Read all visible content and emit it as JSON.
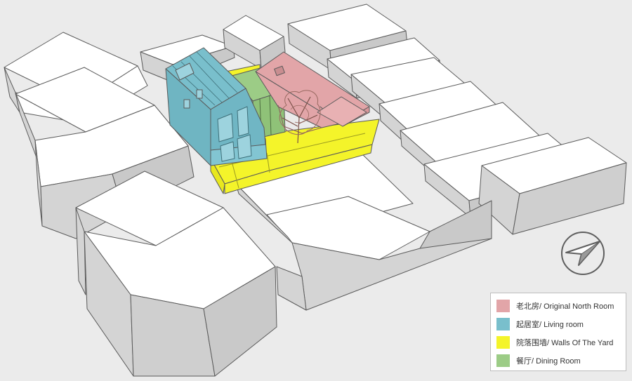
{
  "legend": {
    "items": [
      {
        "label": "老北房/ Original North Room",
        "color": "#e2a5a8"
      },
      {
        "label": "起居室/ Living room",
        "color": "#79bfcc"
      },
      {
        "label": "院落围墙/ Walls Of The Yard",
        "color": "#f4f42a"
      },
      {
        "label": "餐厅/ Dining Room",
        "color": "#9ccc86"
      }
    ]
  },
  "compass": {
    "icon": "north-arrow-icon"
  },
  "colors": {
    "background": "#ebebeb",
    "block_top": "#ffffff",
    "block_side": "#d4d4d4",
    "line": "#5a5a5a",
    "north_room": "#e2a5a8",
    "living_room": "#79bfcc",
    "yard_walls": "#f4f42a",
    "dining_room": "#9ccc86",
    "tree": "#7b5048"
  }
}
